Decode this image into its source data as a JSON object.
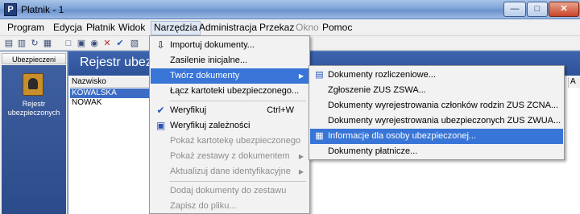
{
  "window": {
    "title": "Płatnik - 1",
    "min_label": "—",
    "max_label": "□",
    "close_label": "✕"
  },
  "menubar": {
    "items": [
      {
        "label": "Program"
      },
      {
        "label": "Edycja"
      },
      {
        "label": "Płatnik"
      },
      {
        "label": "Widok"
      },
      {
        "label": "Narzędzia"
      },
      {
        "label": "Administracja"
      },
      {
        "label": "Przekaz"
      },
      {
        "label": "Okno"
      },
      {
        "label": "Pomoc"
      }
    ]
  },
  "toolbar": {
    "icons": [
      "print-icon",
      "print-preview-icon",
      "refresh-icon",
      "document-icon",
      "new-icon",
      "open-icon",
      "eye-icon",
      "delete-icon",
      "check-icon"
    ]
  },
  "left_panel": {
    "header": "Ubezpieczeni",
    "item_label": "Rejestr ubezpieczonych"
  },
  "main": {
    "title": "Rejestr ubezpieczonych",
    "column_header": "Nazwisko",
    "right_column_header": "A",
    "rows": [
      "KOWALSKA",
      "NOWAK"
    ],
    "selected_row": 0
  },
  "tools_menu": {
    "items": [
      {
        "label": "Importuj dokumenty...",
        "icon": "import-icon",
        "disabled": false
      },
      {
        "label": "Zasilenie inicjalne...",
        "disabled": false
      },
      {
        "label": "Twórz dokumenty",
        "submenu": true,
        "highlighted": true,
        "disabled": false
      },
      {
        "label": "Łącz kartoteki ubezpieczonego...",
        "disabled": false
      },
      {
        "label": "Weryfikuj",
        "shortcut": "Ctrl+W",
        "icon": "check-icon",
        "disabled": false
      },
      {
        "label": "Weryfikuj zależności",
        "icon": "verify-dependencies-icon",
        "disabled": false
      },
      {
        "label": "Pokaż kartotekę ubezpieczonego",
        "disabled": true
      },
      {
        "label": "Pokaż zestawy z dokumentem",
        "submenu": true,
        "disabled": true
      },
      {
        "label": "Aktualizuj dane identyfikacyjne",
        "submenu": true,
        "disabled": true
      },
      {
        "label": "Dodaj dokumenty do zestawu",
        "disabled": true
      },
      {
        "label": "Zapisz do pliku...",
        "disabled": true
      }
    ]
  },
  "create_submenu": {
    "items": [
      {
        "label": "Dokumenty rozliczeniowe...",
        "icon": "documents-icon"
      },
      {
        "label": "Zgłoszenie ZUS ZSWA..."
      },
      {
        "label": "Dokumenty wyrejestrowania członków rodzin ZUS ZCNA..."
      },
      {
        "label": "Dokumenty wyrejestrowania ubezpieczonych ZUS ZWUA..."
      },
      {
        "label": "Informacje dla osoby ubezpieczonej...",
        "icon": "info-card-icon",
        "highlighted": true
      },
      {
        "label": "Dokumenty płatnicze..."
      }
    ]
  }
}
